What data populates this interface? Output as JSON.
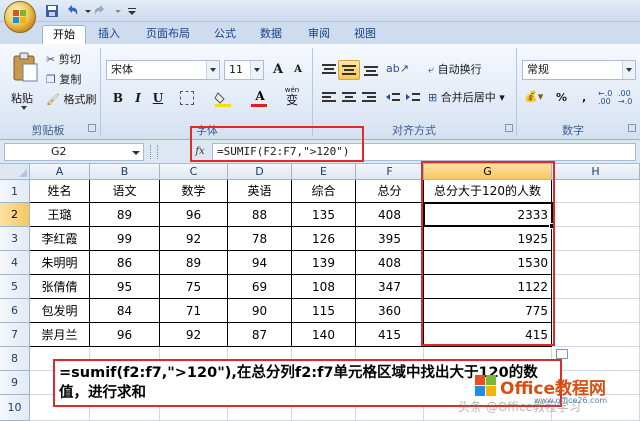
{
  "toolbar": {
    "tabs": [
      {
        "label": "开始",
        "active": true
      },
      {
        "label": "插入"
      },
      {
        "label": "页面布局"
      },
      {
        "label": "公式"
      },
      {
        "label": "数据"
      },
      {
        "label": "审阅"
      },
      {
        "label": "视图"
      }
    ]
  },
  "ribbon": {
    "clipboard": {
      "paste_label": "粘贴",
      "cut_label": "剪切",
      "copy_label": "复制",
      "format_painter_label": "格式刷",
      "group_label": "剪贴板"
    },
    "font": {
      "font_name": "宋体",
      "font_size": "11",
      "bold": "B",
      "italic": "I",
      "underline": "U",
      "grow": "A",
      "shrink": "A",
      "font_color": "A",
      "wen": "wén",
      "phonetic": "变",
      "group_label": "字体"
    },
    "alignment": {
      "wrap_label": "自动换行",
      "merge_label": "合并后居中",
      "group_label": "对齐方式"
    },
    "number": {
      "format": "常规",
      "percent": "%",
      "comma": ",",
      "group_label": "数字"
    }
  },
  "formula_bar": {
    "name_box": "G2",
    "fx": "fx",
    "formula": "=SUMIF(F2:F7,\">120\")"
  },
  "grid": {
    "columns": [
      "A",
      "B",
      "C",
      "D",
      "E",
      "F",
      "G",
      "H"
    ],
    "rows": [
      "1",
      "2",
      "3",
      "4",
      "5",
      "6",
      "7",
      "8",
      "9",
      "10"
    ],
    "headers": [
      "姓名",
      "语文",
      "数学",
      "英语",
      "综合",
      "总分",
      "总分大于120的人数"
    ],
    "data": [
      [
        "王璐",
        "89",
        "96",
        "88",
        "135",
        "408",
        "2333"
      ],
      [
        "李红霞",
        "99",
        "92",
        "78",
        "126",
        "395",
        "1925"
      ],
      [
        "朱明明",
        "86",
        "89",
        "94",
        "139",
        "408",
        "1530"
      ],
      [
        "张倩倩",
        "95",
        "75",
        "69",
        "108",
        "347",
        "1122"
      ],
      [
        "包发明",
        "84",
        "71",
        "90",
        "115",
        "360",
        "775"
      ],
      [
        "崇月兰",
        "96",
        "92",
        "87",
        "140",
        "415",
        "415"
      ]
    ],
    "selected_cell": "G2"
  },
  "annotation": {
    "text": "=sumif(f2:f7,\">120\"),在总分列f2:f7单元格区域中找出大于120的数值，进行求和"
  },
  "watermark": {
    "main": "Office教程网",
    "sub": "www.office26.com",
    "faint": "头条 @Office教程学习"
  },
  "colors": {
    "highlight": "#e02a2a",
    "selection": "#f6c860",
    "ribbon": "#dde7f4"
  }
}
